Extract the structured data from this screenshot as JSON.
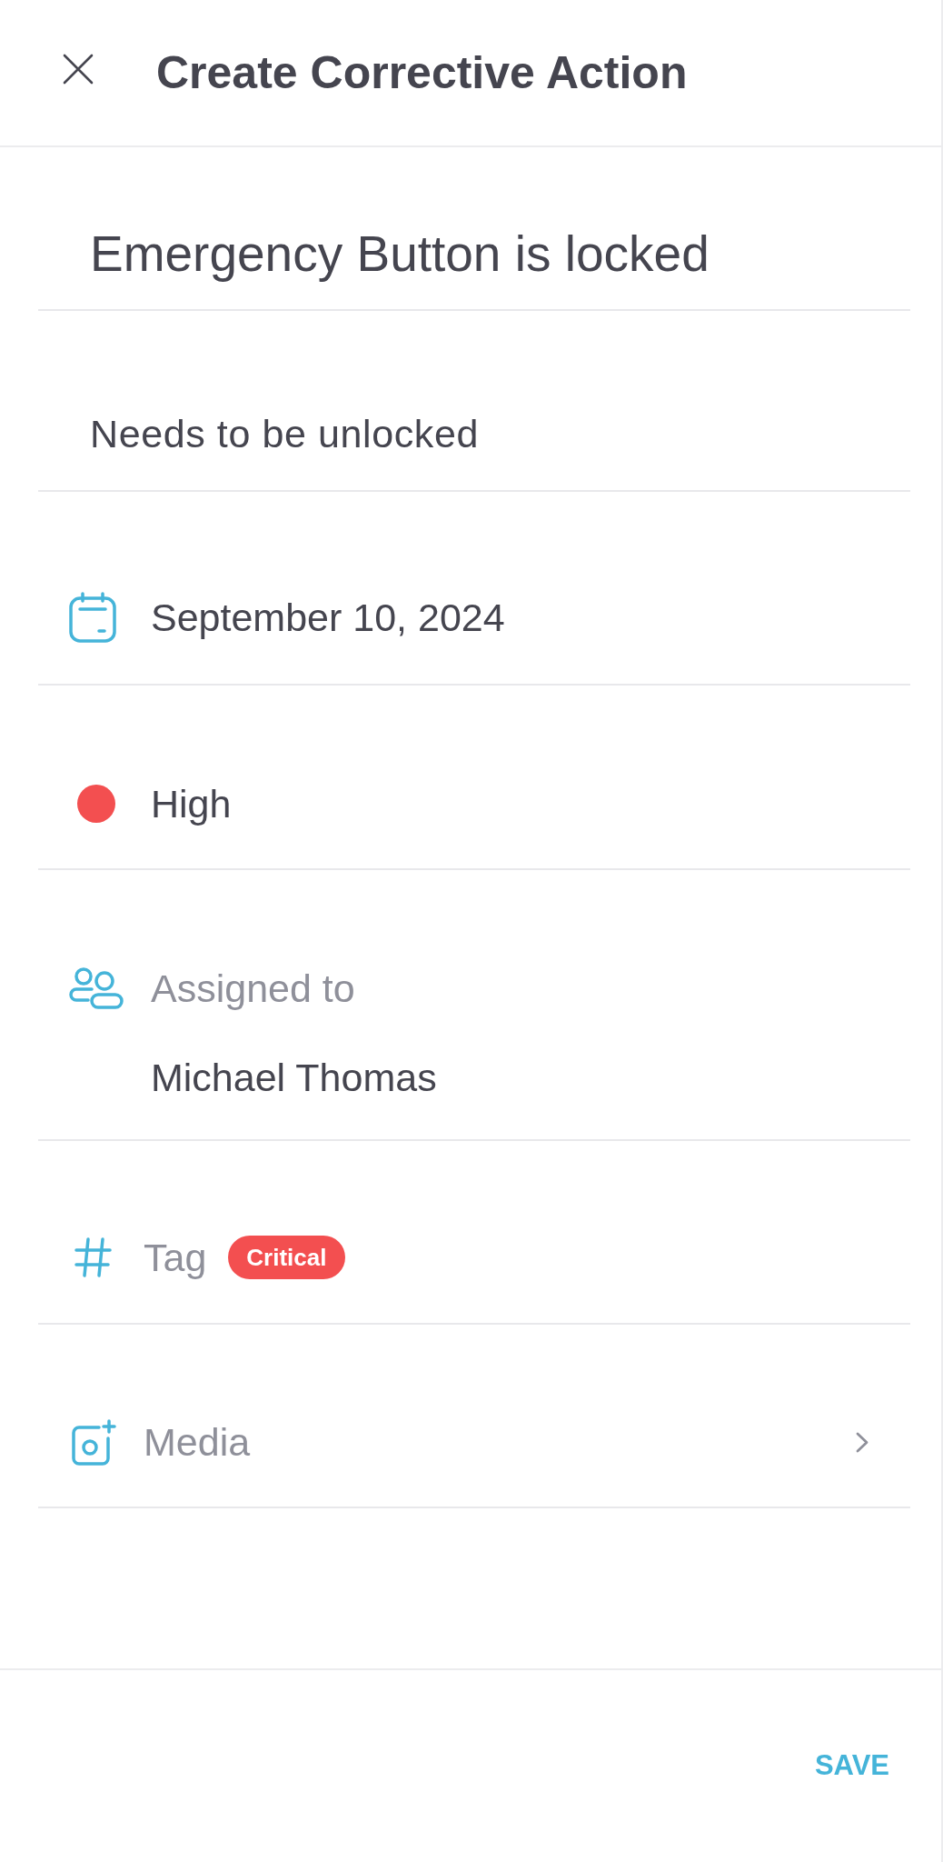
{
  "header": {
    "title": "Create Corrective Action"
  },
  "title_field": {
    "value": "Emergency Button is locked"
  },
  "description_field": {
    "value": "Needs to be unlocked"
  },
  "rows": [
    {
      "kind": "date",
      "value": "September 10, 2024"
    },
    {
      "kind": "priority",
      "value": "High",
      "color": "#f34f50"
    },
    {
      "kind": "assignee",
      "label": "Assigned to",
      "value": "Michael Thomas"
    },
    {
      "kind": "tag",
      "label": "Tag",
      "tags": [
        {
          "label": "Critical",
          "color": "#f34f50"
        }
      ]
    },
    {
      "kind": "media",
      "label": "Media"
    }
  ],
  "footer": {
    "save_button": "SAVE"
  }
}
